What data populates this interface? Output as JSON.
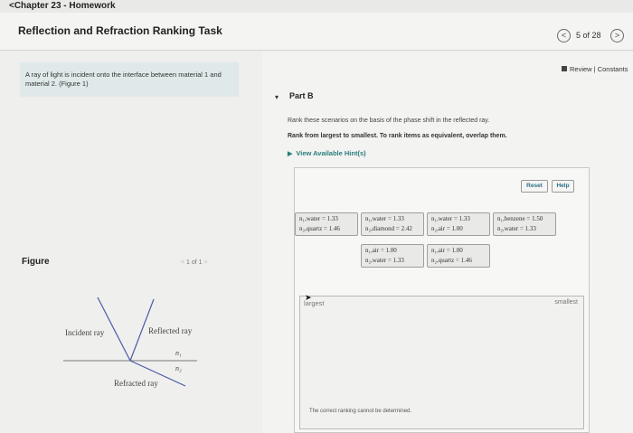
{
  "header": {
    "back_link": "<Chapter 23 - Homework",
    "title": "Reflection and Refraction Ranking Task",
    "nav_prev": "<",
    "page_count": "5 of 28",
    "nav_next": ">"
  },
  "left": {
    "intro": "A ray of light is incident onto the interface between material 1 and material 2. (Figure 1)",
    "figure_label": "Figure",
    "figure_pager": "1 of 1",
    "pager_prev": "<",
    "pager_next": ">",
    "diagram": {
      "incident": "Incident ray",
      "reflected": "Reflected ray",
      "n1": "n₁",
      "n2": "n₂",
      "refracted": "Refracted ray"
    }
  },
  "right": {
    "review_link": "Review | Constants",
    "part_caret": "▾",
    "part_title": "Part B",
    "instruction1": "Rank these scenarios on the basis of the phase shift in the reflected ray.",
    "instruction2": "Rank from largest to smallest. To rank items as equivalent, overlap them.",
    "hints": "View Available Hint(s)",
    "reset": "Reset",
    "help": "Help",
    "chips": [
      {
        "line1": "n₁,water = 1.33",
        "line2": "n₂,quartz = 1.46"
      },
      {
        "line1": "n₁,water = 1.33",
        "line2": "n₂,diamond = 2.42"
      },
      {
        "line1": "n₁,water = 1.33",
        "line2": "n₂,air = 1.00"
      },
      {
        "line1": "n₁,benzene = 1.50",
        "line2": "n₂,water = 1.33"
      },
      {
        "line1": "n₁,air = 1.00",
        "line2": "n₂,water = 1.33"
      },
      {
        "line1": "n₁,air = 1.00",
        "line2": "n₂,quartz = 1.46"
      }
    ],
    "largest": "largest",
    "smallest": "smallest",
    "undetermined": "The correct ranking cannot be determined."
  }
}
